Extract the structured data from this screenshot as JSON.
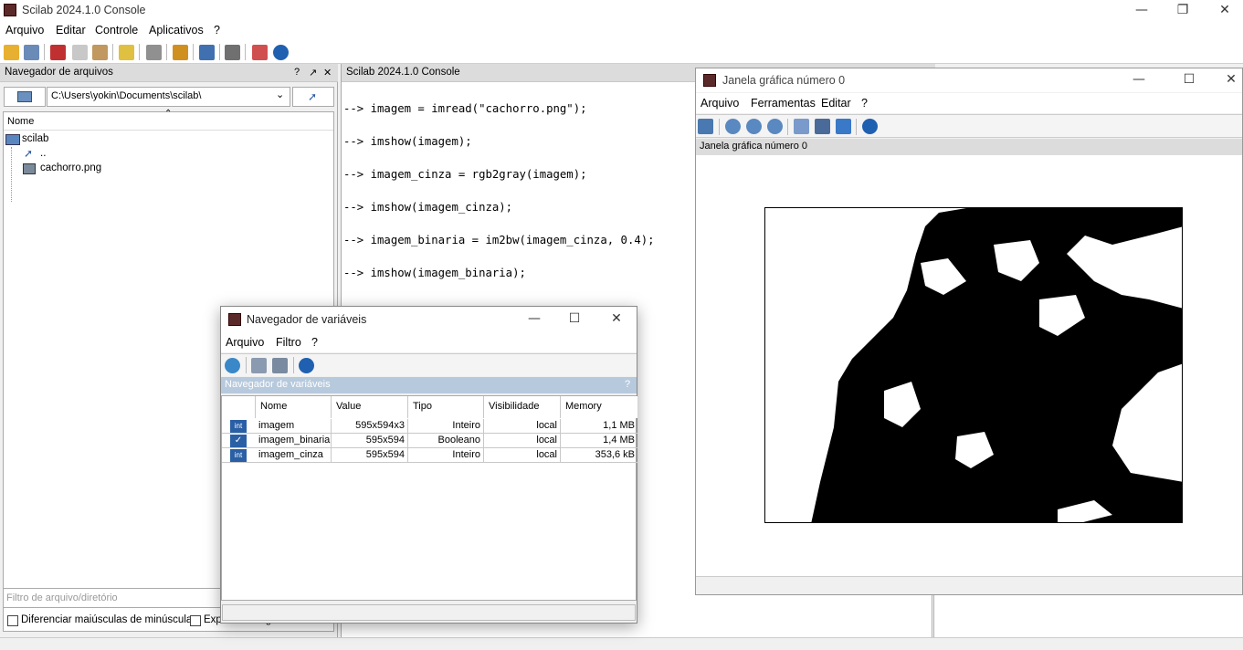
{
  "window": {
    "title": "Scilab 2024.1.0 Console"
  },
  "menu": [
    "Arquivo",
    "Editar",
    "Controle",
    "Aplicativos",
    "?"
  ],
  "toolbar_icons": [
    "new-script-icon",
    "open-file-icon",
    "cut-icon",
    "copy-icon",
    "paste-icon",
    "clear-icon",
    "print-icon",
    "var-browser-icon",
    "demo-icon",
    "tools-icon",
    "help-browser-icon",
    "help-icon"
  ],
  "file_browser": {
    "header": "Navegador de arquivos",
    "header_controls": [
      "?",
      "↗",
      "✕"
    ],
    "path": "C:\\Users\\yokin\\Documents\\scilab\\",
    "column_name": "Nome",
    "tree": [
      {
        "label": "scilab",
        "icon": "folder-icon"
      },
      {
        "label": "..",
        "icon": "up-arrow-icon"
      },
      {
        "label": "cachorro.png",
        "icon": "image-file-icon"
      }
    ],
    "filter_placeholder": "Filtro de arquivo/diretório",
    "check_case": "Diferenciar maiúsculas de minúsculas",
    "check_regex": "Expressão regular"
  },
  "console": {
    "header": "Scilab 2024.1.0 Console",
    "lines": [
      "--> imagem = imread(\"cachorro.png\");",
      "--> imshow(imagem);",
      "--> imagem_cinza = rgb2gray(imagem);",
      "--> imshow(imagem_cinza);",
      "--> imagem_binaria = im2bw(imagem_cinza, 0.4);",
      "--> imshow(imagem_binaria);"
    ]
  },
  "graphic_window": {
    "title": "Janela gráfica número 0",
    "menu": [
      "Arquivo",
      "Ferramentas",
      "Editar",
      "?"
    ],
    "tab_label": "Janela gráfica número 0",
    "toolbar_icons": [
      "rotate-icon",
      "zoom-area-icon",
      "zoom-in-icon",
      "zoom-out-icon",
      "datatip-icon",
      "edit-axes-icon",
      "pan-icon",
      "help-icon"
    ]
  },
  "variable_browser": {
    "title": "Navegador de variáveis",
    "menu": [
      "Arquivo",
      "Filtro",
      "?"
    ],
    "header": "Navegador de variáveis",
    "header_help": "?",
    "columns": [
      "Nome",
      "Value",
      "Tipo",
      "Visibilidade",
      "Memory"
    ],
    "rows": [
      {
        "icon": "int",
        "name": "imagem",
        "value": "595x594x3",
        "type": "Inteiro",
        "visibility": "local",
        "memory": "1,1 MB"
      },
      {
        "icon": "bool",
        "name": "imagem_binaria",
        "value": "595x594",
        "type": "Booleano",
        "visibility": "local",
        "memory": "1,4 MB"
      },
      {
        "icon": "int",
        "name": "imagem_cinza",
        "value": "595x594",
        "type": "Inteiro",
        "visibility": "local",
        "memory": "353,6 kB"
      }
    ],
    "row_int_label": "int"
  },
  "colors": {
    "panel_header": "#dcdcdc",
    "vb_header": "#b7c9dd",
    "selection": "#c9d9ee"
  }
}
